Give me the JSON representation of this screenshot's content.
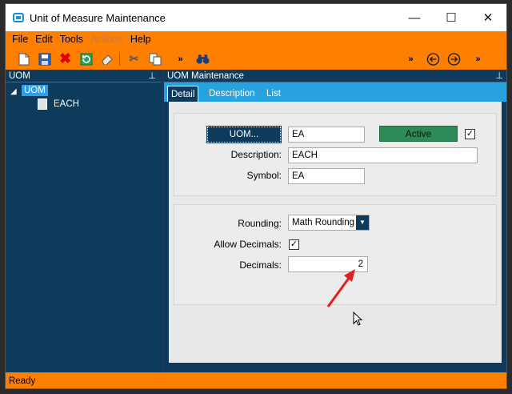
{
  "window": {
    "title": "Unit of Measure Maintenance"
  },
  "menu": {
    "file": "File",
    "edit": "Edit",
    "tools": "Tools",
    "actions": "Actions",
    "help": "Help"
  },
  "left_panel": {
    "header": "UOM",
    "tree": {
      "root": "UOM",
      "children": [
        "EACH"
      ]
    }
  },
  "right_panel": {
    "header": "UOM Maintenance",
    "tabs": [
      "Detail",
      "Description",
      "List"
    ]
  },
  "form": {
    "uom_button": "UOM...",
    "uom_value": "EA",
    "active_label": "Active",
    "active_checked": true,
    "description_label": "Description:",
    "description_value": "EACH",
    "symbol_label": "Symbol:",
    "symbol_value": "EA",
    "rounding_label": "Rounding:",
    "rounding_value": "Math Rounding",
    "allow_decimals_label": "Allow Decimals:",
    "allow_decimals_checked": true,
    "decimals_label": "Decimals:",
    "decimals_value": "2"
  },
  "status": {
    "text": "Ready"
  },
  "colors": {
    "accent": "#ff8000",
    "panel": "#0e3a5c",
    "tab_bar": "#29a3e0",
    "active": "#2e8b57",
    "annotation_arrow": "#e02020"
  },
  "icons": [
    "new-icon",
    "save-icon",
    "delete-icon",
    "refresh-icon",
    "eraser-icon",
    "cut-icon",
    "copy-icon",
    "more-icon",
    "binoculars-icon",
    "back-icon",
    "forward-icon",
    "pin-icon"
  ]
}
